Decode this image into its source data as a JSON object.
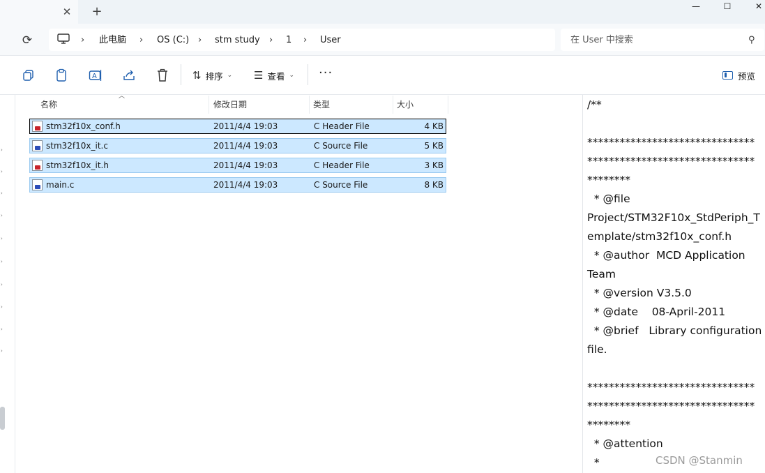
{
  "tab": {
    "close_icon": "close-icon",
    "new_tab_icon": "plus-icon"
  },
  "window": {
    "minimize": "—",
    "maximize": "☐",
    "close": "✕"
  },
  "address": {
    "crumbs": [
      "此电脑",
      "OS (C:)",
      "stm study",
      "1",
      "User"
    ],
    "search_placeholder": "在 User 中搜索"
  },
  "toolbar": {
    "sort_label": "排序",
    "view_label": "查看",
    "more_label": "···",
    "preview_label": "预览"
  },
  "columns": {
    "name": "名称",
    "date": "修改日期",
    "type": "类型",
    "size": "大小"
  },
  "files": [
    {
      "name": "stm32f10x_conf.h",
      "date": "2011/4/4 19:03",
      "type": "C Header File",
      "size": "4 KB",
      "kind": "header"
    },
    {
      "name": "stm32f10x_it.c",
      "date": "2011/4/4 19:03",
      "type": "C Source File",
      "size": "5 KB",
      "kind": "source"
    },
    {
      "name": "stm32f10x_it.h",
      "date": "2011/4/4 19:03",
      "type": "C Header File",
      "size": "3 KB",
      "kind": "header"
    },
    {
      "name": "main.c",
      "date": "2011/4/4 19:03",
      "type": "C Source File",
      "size": "8 KB",
      "kind": "source"
    }
  ],
  "preview_lines": [
    "/**",
    "",
    "*******************************",
    "*******************************",
    "********",
    "  * @file",
    "Project/STM32F10x_StdPeriph_T",
    "emplate/stm32f10x_conf.h",
    "  * @author  MCD Application",
    "Team",
    "  * @version V3.5.0",
    "  * @date    08-April-2011",
    "  * @brief   Library configuration",
    "file.",
    "",
    "*******************************",
    "*******************************",
    "********",
    "  * @attention",
    "  *"
  ],
  "watermark": "CSDN @Stanmin",
  "colors": {
    "selection": "#cce8ff",
    "selection_border": "#99c9f0",
    "accent": "#1f5fae"
  }
}
